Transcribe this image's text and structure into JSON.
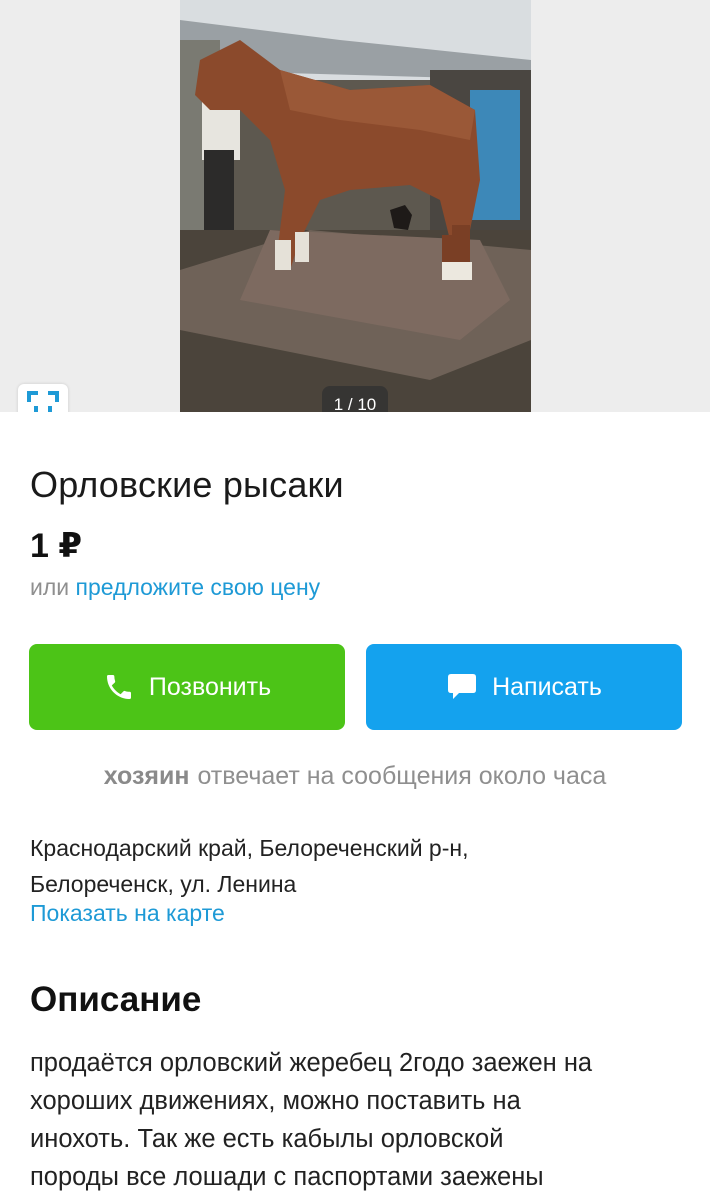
{
  "gallery": {
    "counter": "1 / 10",
    "fullscreen_icon": "fullscreen-icon"
  },
  "listing": {
    "title": "Орловские рысаки",
    "price": "1 ₽",
    "offer_prefix": "или",
    "offer_link": "предложите свою цену"
  },
  "actions": {
    "call_label": "Позвонить",
    "call_icon": "phone-icon",
    "call_color": "#4cc417",
    "write_label": "Написать",
    "write_icon": "chat-bubble-icon",
    "write_color": "#14a2ee"
  },
  "seller": {
    "name": "хозяин",
    "response_text": "отвечает на сообщения около часа"
  },
  "location": {
    "line1": "Краснодарский край, Белореченский р-н,",
    "line2": "Белореченск, ул. Ленина",
    "map_link": "Показать на карте"
  },
  "description": {
    "heading": "Описание",
    "lines": [
      "продаётся орловский жеребец 2годо заежен на",
      "хороших движениях, можно поставить на",
      "инохоть. Так же есть кабылы орловской",
      "породы все лошади с паспортами заежены"
    ]
  }
}
